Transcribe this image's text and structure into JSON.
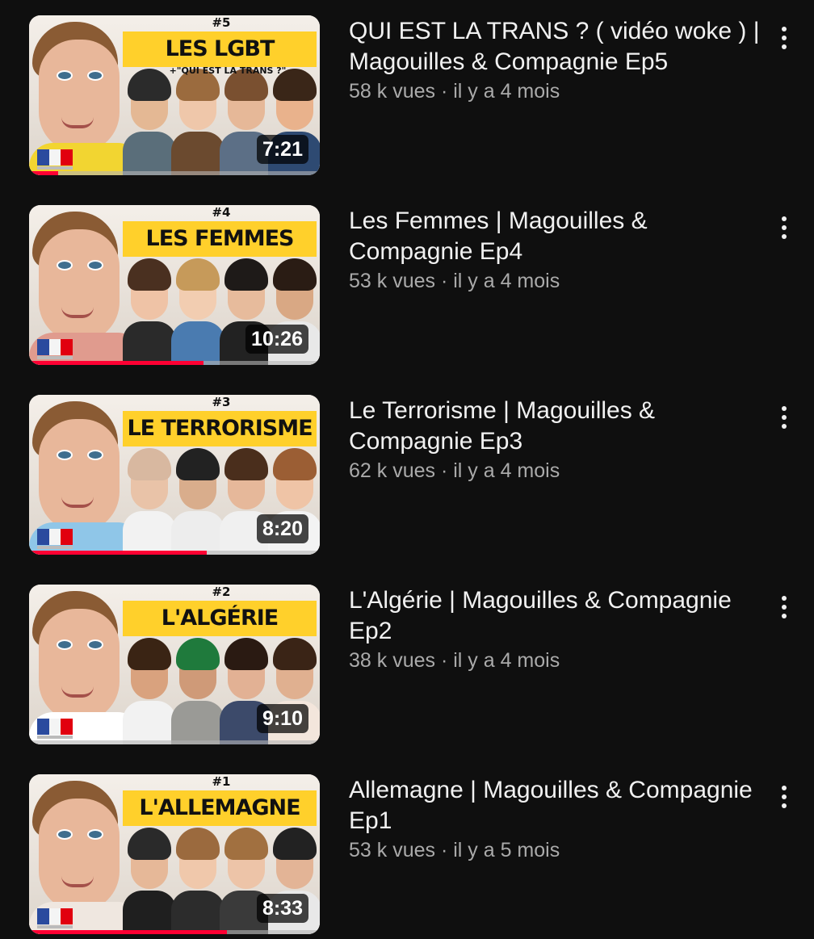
{
  "colors": {
    "background": "#0f0f0f",
    "title_text": "#f1f1f1",
    "stats_text": "#aaaaaa",
    "progress": "#ff0033",
    "thumbnail_banner": "#ffd02b"
  },
  "videos": [
    {
      "title": "QUI EST LA TRANS ? ( vidéo woke ) | Magouilles & Compagnie Ep5",
      "views": "58 k vues",
      "age": "il y a 4 mois",
      "duration": "7:21",
      "watched_fraction": 0.1,
      "thumbnail": {
        "ep": "#5",
        "banner": "LES LGBT",
        "subtitle": "+\"QUI EST LA TRANS ?\"",
        "host_shirt": "#f2d531",
        "guest_palette": [
          [
            "#2b2b2b",
            "#e4b894",
            "#5a6e7a"
          ],
          [
            "#9b6b3e",
            "#efc7aa",
            "#6b4a2f"
          ],
          [
            "#7a5030",
            "#e6b898",
            "#5c6f86"
          ],
          [
            "#3a2618",
            "#e9b28c",
            "#2e4a72"
          ]
        ]
      },
      "more_icon": "more-vert-icon"
    },
    {
      "title": "Les Femmes | Magouilles & Compagnie Ep4",
      "views": "53 k vues",
      "age": "il y a 4 mois",
      "duration": "10:26",
      "watched_fraction": 0.6,
      "thumbnail": {
        "ep": "#4",
        "banner": "LES FEMMES",
        "subtitle": "",
        "host_shirt": "#e09b8e",
        "guest_palette": [
          [
            "#4a3020",
            "#efc3a6",
            "#2a2a2a"
          ],
          [
            "#c69a5a",
            "#f2cdb1",
            "#4a7bb0"
          ],
          [
            "#1e1a18",
            "#e7bb9c",
            "#222222"
          ],
          [
            "#2a1c14",
            "#d9a884",
            "#e8e8e8"
          ]
        ]
      },
      "more_icon": "more-vert-icon"
    },
    {
      "title": "Le Terrorisme | Magouilles & Compagnie Ep3",
      "views": "62 k vues",
      "age": "il y a 4 mois",
      "duration": "8:20",
      "watched_fraction": 0.61,
      "thumbnail": {
        "ep": "#3",
        "banner": "LE TERRORISME",
        "subtitle": "",
        "host_shirt": "#8fc6e8",
        "guest_palette": [
          [
            "#d8b8a0",
            "#e9c3a8",
            "#f2f2f2"
          ],
          [
            "#222222",
            "#d9ad8c",
            "#ededed"
          ],
          [
            "#4a2e1c",
            "#e6b89a",
            "#f0f0f0"
          ],
          [
            "#9b5e34",
            "#efc4a6",
            "#f3f3f3"
          ]
        ]
      },
      "more_icon": "more-vert-icon"
    },
    {
      "title": "L'Algérie | Magouilles & Compagnie Ep2",
      "views": "38 k vues",
      "age": "il y a 4 mois",
      "duration": "9:10",
      "watched_fraction": 0.0,
      "thumbnail": {
        "ep": "#2",
        "banner": "L'ALGÉRIE",
        "subtitle": "",
        "host_shirt": "#ffffff",
        "guest_palette": [
          [
            "#3a2414",
            "#d9a27e",
            "#f2f2f2"
          ],
          [
            "#1f7a3c",
            "#cf9a78",
            "#9a9a96"
          ],
          [
            "#2a1a12",
            "#e2b194",
            "#3c4a6a"
          ],
          [
            "#3a2416",
            "#e0b090",
            "#f3e6dc"
          ]
        ]
      },
      "more_icon": "more-vert-icon"
    },
    {
      "title": "Allemagne | Magouilles & Compagnie Ep1",
      "views": "53 k vues",
      "age": "il y a 5 mois",
      "duration": "8:33",
      "watched_fraction": 0.68,
      "thumbnail": {
        "ep": "#1",
        "banner": "L'ALLEMAGNE",
        "subtitle": "",
        "host_shirt": "#efe7e0",
        "guest_palette": [
          [
            "#2a2a2a",
            "#e6b898",
            "#1f1f1f"
          ],
          [
            "#9b6a3e",
            "#f0c8ab",
            "#2c2c2c"
          ],
          [
            "#a17040",
            "#edc4a8",
            "#3a3a3a"
          ],
          [
            "#222222",
            "#e3b496",
            "#e8e8e8"
          ]
        ]
      },
      "more_icon": "more-vert-icon"
    }
  ]
}
